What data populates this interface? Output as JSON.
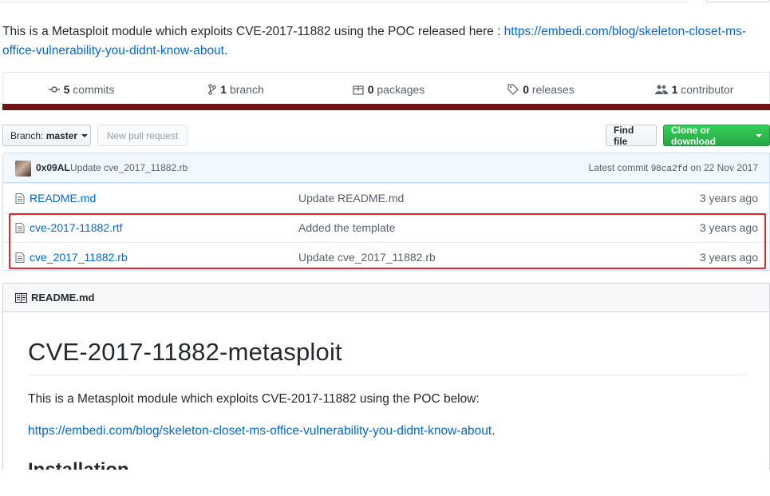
{
  "description": {
    "text": "This is a Metasploit module which exploits CVE-2017-11882 using the POC released here : ",
    "link": "https://embedi.com/blog/skeleton-closet-ms-office-vulnerability-you-didnt-know-about",
    "trailing": "."
  },
  "summary": {
    "commits": {
      "count": "5",
      "label": "commits"
    },
    "branches": {
      "count": "1",
      "label": "branch"
    },
    "packages": {
      "count": "0",
      "label": "packages"
    },
    "releases": {
      "count": "0",
      "label": "releases"
    },
    "contributors": {
      "count": "1",
      "label": "contributor"
    },
    "language_color": "#701516"
  },
  "toolbar": {
    "branch_prefix": "Branch:",
    "branch_name": "master",
    "new_pull_request": "New pull request",
    "find_file": "Find file",
    "clone_or_download": "Clone or download"
  },
  "latest_commit": {
    "author": "0x09AL",
    "message": "Update cve_2017_11882.rb",
    "prefix": "Latest commit",
    "sha": "98ca2fd",
    "date": "on 22 Nov 2017"
  },
  "files": [
    {
      "name": "README.md",
      "message": "Update README.md",
      "age": "3 years ago"
    },
    {
      "name": "cve-2017-11882.rtf",
      "message": "Added the template",
      "age": "3 years ago"
    },
    {
      "name": "cve_2017_11882.rb",
      "message": "Update cve_2017_11882.rb",
      "age": "3 years ago"
    }
  ],
  "readme": {
    "header": "README.md",
    "title": "CVE-2017-11882-metasploit",
    "paragraph": "This is a Metasploit module which exploits CVE-2017-11882 using the POC below:",
    "link": "https://embedi.com/blog/skeleton-closet-ms-office-vulnerability-you-didnt-know-about",
    "link_trailing": ".",
    "next_heading": "Installation"
  },
  "colors": {
    "link": "#0366d6",
    "highlight_box": "#e5262b",
    "clone_button": "#28a745"
  }
}
